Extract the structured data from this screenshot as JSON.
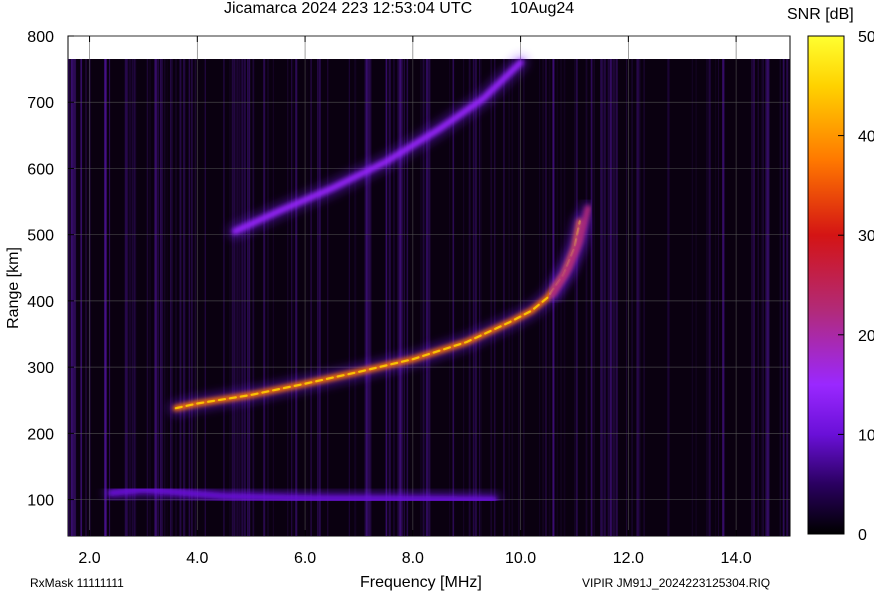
{
  "header": {
    "title": "Jicamarca 2024 223 12:53:04 UTC",
    "date": "10Aug24"
  },
  "footer": {
    "rx_mask": "RxMask 11111111",
    "file_label": "VIPIR  JM91J_2024223125304.RIQ"
  },
  "chart_data": {
    "type": "heatmap",
    "title": "Jicamarca 2024 223 12:53:04 UTC",
    "xlabel": "Frequency [MHz]",
    "ylabel": "Range [km]",
    "colorbar_label": "SNR [dB]",
    "xlim": [
      1.6,
      15.0
    ],
    "ylim": [
      45,
      800
    ],
    "x_ticks": [
      "2.0",
      "4.0",
      "6.0",
      "8.0",
      "10.0",
      "12.0",
      "14.0"
    ],
    "y_ticks": [
      "100",
      "200",
      "300",
      "400",
      "500",
      "600",
      "700",
      "800"
    ],
    "colorbar_range": [
      0,
      50
    ],
    "colorbar_ticks": [
      "0",
      "10",
      "20",
      "30",
      "40",
      "50"
    ],
    "grid": true,
    "colormap": [
      "#000000",
      "#2a0060",
      "#6a10d8",
      "#9a28ff",
      "#b22a78",
      "#d41414",
      "#ff7800",
      "#ffd200",
      "#ffff30"
    ],
    "traces": [
      {
        "name": "",
        "points": [
          [
            2.4,
            110
          ],
          [
            3.0,
            115
          ],
          [
            3.5,
            112
          ],
          [
            4.5,
            105
          ],
          [
            6.0,
            102
          ],
          [
            8.0,
            101
          ],
          [
            9.5,
            100
          ]
        ],
        "snr": 15
      },
      {
        "name": "",
        "points": [
          [
            3.6,
            238
          ],
          [
            4.0,
            245
          ],
          [
            5.0,
            258
          ],
          [
            6.0,
            275
          ],
          [
            7.0,
            293
          ],
          [
            8.0,
            312
          ],
          [
            9.0,
            338
          ],
          [
            9.8,
            368
          ],
          [
            10.2,
            385
          ],
          [
            10.5,
            405
          ],
          [
            10.8,
            440
          ],
          [
            11.0,
            480
          ],
          [
            11.1,
            520
          ]
        ],
        "snr": 36
      },
      {
        "name": "",
        "points": [
          [
            10.6,
            410
          ],
          [
            10.9,
            450
          ],
          [
            11.1,
            490
          ],
          [
            11.25,
            540
          ]
        ],
        "snr": 28
      },
      {
        "name": "",
        "points": [
          [
            4.7,
            505
          ],
          [
            5.5,
            535
          ],
          [
            6.5,
            570
          ],
          [
            7.5,
            610
          ],
          [
            8.5,
            660
          ],
          [
            9.3,
            705
          ],
          [
            10.0,
            760
          ]
        ],
        "snr": 18
      }
    ]
  }
}
